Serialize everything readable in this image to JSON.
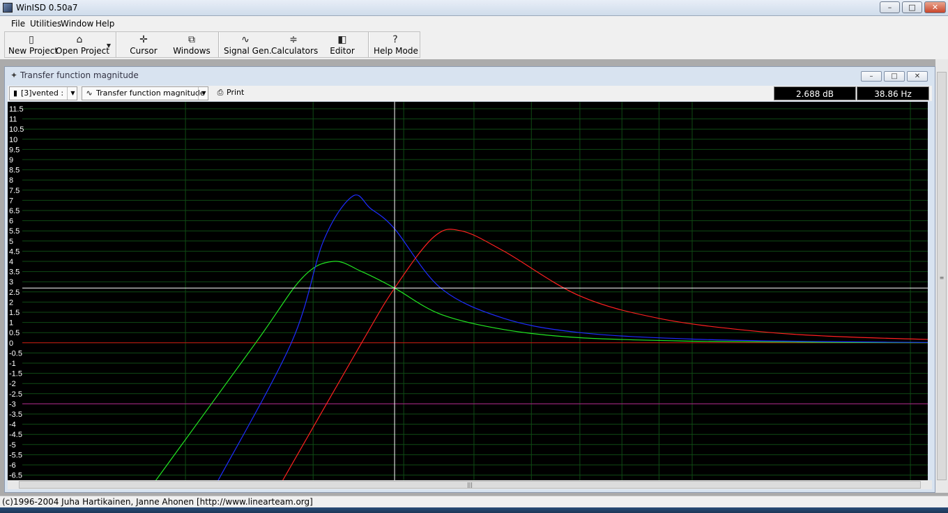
{
  "window": {
    "title": "WinISD 0.50a7",
    "controls": {
      "minimize": "–",
      "maximize": "□",
      "close": "✕"
    }
  },
  "menu": {
    "items": [
      {
        "label": "File"
      },
      {
        "label": "Utilities"
      },
      {
        "label": "Window"
      },
      {
        "label": "Help"
      }
    ]
  },
  "toolbar": {
    "buttons": [
      {
        "label": "New Project",
        "icon": "new-file-icon"
      },
      {
        "label": "Open Project",
        "icon": "open-folder-icon"
      },
      {
        "label": "Cursor",
        "icon": "crosshair-icon"
      },
      {
        "label": "Windows",
        "icon": "windows-icon"
      },
      {
        "label": "Signal Gen.",
        "icon": "sine-wave-icon"
      },
      {
        "label": "Calculators",
        "icon": "calculator-icon"
      },
      {
        "label": "Editor",
        "icon": "speaker-icon"
      },
      {
        "label": "Help Mode",
        "icon": "question-icon"
      }
    ]
  },
  "graph_window": {
    "title": "Transfer function magnitude",
    "project_select": "[3]vented :",
    "graph_type_select": "Transfer function magnitude",
    "print_label": "Print",
    "readout_db": "2.688 dB",
    "readout_hz": "38.86 Hz"
  },
  "status_bar": {
    "text": "(c)1996-2004 Juha Hartikainen, Janne Ahonen [http://www.linearteam.org]"
  },
  "chart_data": {
    "type": "line",
    "title": "",
    "xlabel": "",
    "ylabel": "",
    "y_ticks": [
      "11.5",
      "11",
      "10.5",
      "10",
      "9.5",
      "9",
      "8.5",
      "8",
      "7.5",
      "7",
      "6.5",
      "6",
      "5.5",
      "5",
      "4.5",
      "4",
      "3.5",
      "3",
      "2.5",
      "2",
      "1.5",
      "1",
      "0.5",
      "0",
      "-0.5",
      "-1",
      "-1.5",
      "-2",
      "-2.5",
      "-3",
      "-3.5",
      "-4",
      "-4.5",
      "-5",
      "-5.5",
      "-6",
      "-6.5"
    ],
    "ylim": [
      -6.5,
      11.5
    ],
    "reference_line_db": -3,
    "zero_line_db": 0,
    "cursor": {
      "db": 2.688,
      "hz": 38.86
    },
    "colors": {
      "background": "#000000",
      "grid": "#0f4a14",
      "series_blue": "#1e2cff",
      "series_green": "#22e622",
      "series_red": "#ff2020",
      "minus3_line": "#b0208a",
      "zero_line": "#d01010",
      "cursor": "#ffffff"
    },
    "series": [
      {
        "color": "green",
        "points": [
          [
            18,
            -7
          ],
          [
            25,
            0
          ],
          [
            29,
            3.2
          ],
          [
            32,
            4.0
          ],
          [
            35,
            3.5
          ],
          [
            38.86,
            2.688
          ],
          [
            45,
            1.4
          ],
          [
            55,
            0.65
          ],
          [
            70,
            0.25
          ],
          [
            100,
            0.08
          ],
          [
            150,
            0.02
          ],
          [
            250,
            0.0
          ]
        ]
      },
      {
        "color": "blue",
        "points": [
          [
            22,
            -7
          ],
          [
            28,
            0
          ],
          [
            31,
            5.0
          ],
          [
            34,
            7.2
          ],
          [
            36,
            6.6
          ],
          [
            38.86,
            5.6
          ],
          [
            45,
            2.688
          ],
          [
            55,
            1.2
          ],
          [
            70,
            0.5
          ],
          [
            100,
            0.18
          ],
          [
            150,
            0.06
          ],
          [
            250,
            0.0
          ]
        ]
      },
      {
        "color": "red",
        "points": [
          [
            27,
            -7
          ],
          [
            35,
            0
          ],
          [
            38.86,
            2.688
          ],
          [
            44,
            5.2
          ],
          [
            48,
            5.5
          ],
          [
            55,
            4.5
          ],
          [
            70,
            2.3
          ],
          [
            90,
            1.2
          ],
          [
            120,
            0.6
          ],
          [
            160,
            0.3
          ],
          [
            250,
            0.1
          ],
          [
            330,
            0.0
          ]
        ]
      }
    ]
  }
}
